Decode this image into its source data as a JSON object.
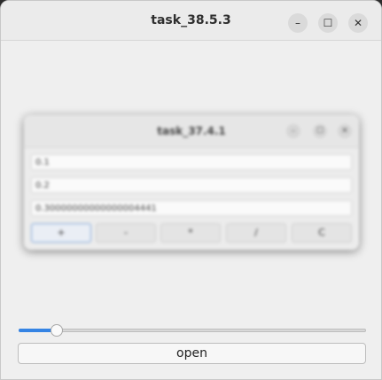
{
  "window": {
    "title": "task_38.5.3",
    "controls": {
      "minimize": "–",
      "maximize": "☐",
      "close": "✕"
    }
  },
  "preview": {
    "title": "task_37.4.1",
    "controls": {
      "minimize": "–",
      "maximize": "☐",
      "close": "✕"
    },
    "fields": [
      "0.1",
      "0.2",
      "0.30000000000000004441"
    ],
    "buttons": [
      "+",
      "-",
      "*",
      "/",
      "C"
    ]
  },
  "slider": {
    "value_fraction": 0.11,
    "accent": "#3584e4"
  },
  "open_button": {
    "label": "open"
  }
}
